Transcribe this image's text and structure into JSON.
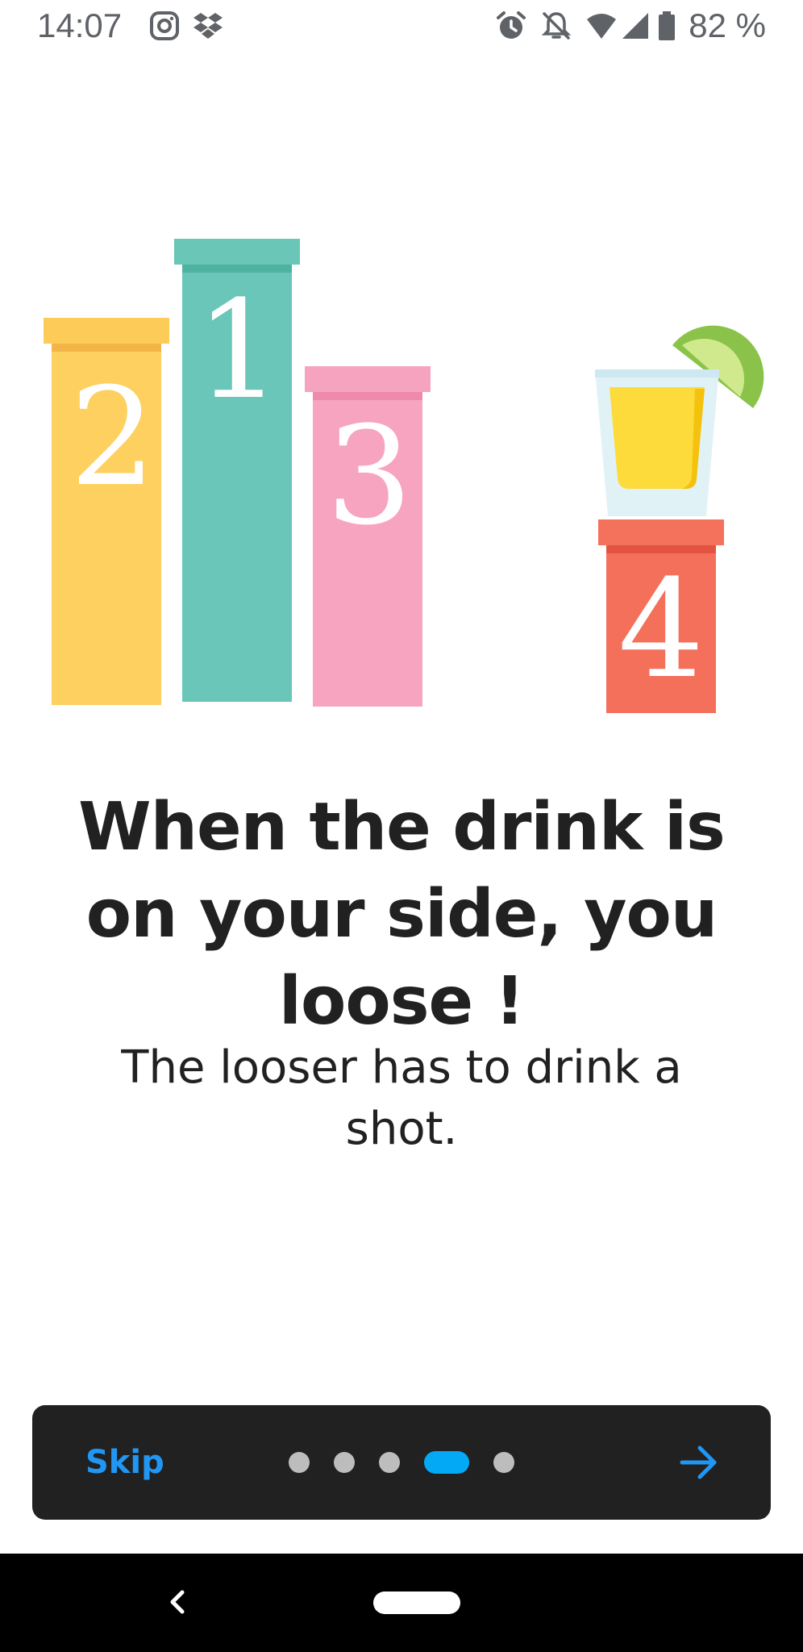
{
  "status_bar": {
    "time": "14:07",
    "left_icons": [
      "instagram-icon",
      "dropbox-icon"
    ],
    "right_icons": [
      "alarm-icon",
      "notifications-off-icon",
      "wifi-icon",
      "signal-icon",
      "battery-icon"
    ],
    "battery": "82 %"
  },
  "illustration": {
    "podiums": [
      {
        "rank": "2",
        "color": "#fdd05f"
      },
      {
        "rank": "1",
        "color": "#69c6b8"
      },
      {
        "rank": "3",
        "color": "#f7a4c0"
      },
      {
        "rank": "4",
        "color": "#f4705b"
      }
    ],
    "icons": [
      "podium-icon",
      "shot-glass-icon",
      "lime-wedge-icon"
    ]
  },
  "onboarding": {
    "title": "When the drink is on your side, you loose !",
    "subtitle": "The looser has to drink a shot."
  },
  "intro_bar": {
    "skip_label": "Skip",
    "page_indicator": {
      "total": 5,
      "current": 4
    },
    "next_icon": "arrow-right-icon",
    "accent_color": "#2196f3",
    "active_dot_color": "#03a9f4"
  },
  "nav_bar": {
    "icons": [
      "back-icon",
      "home-pill-icon"
    ]
  }
}
